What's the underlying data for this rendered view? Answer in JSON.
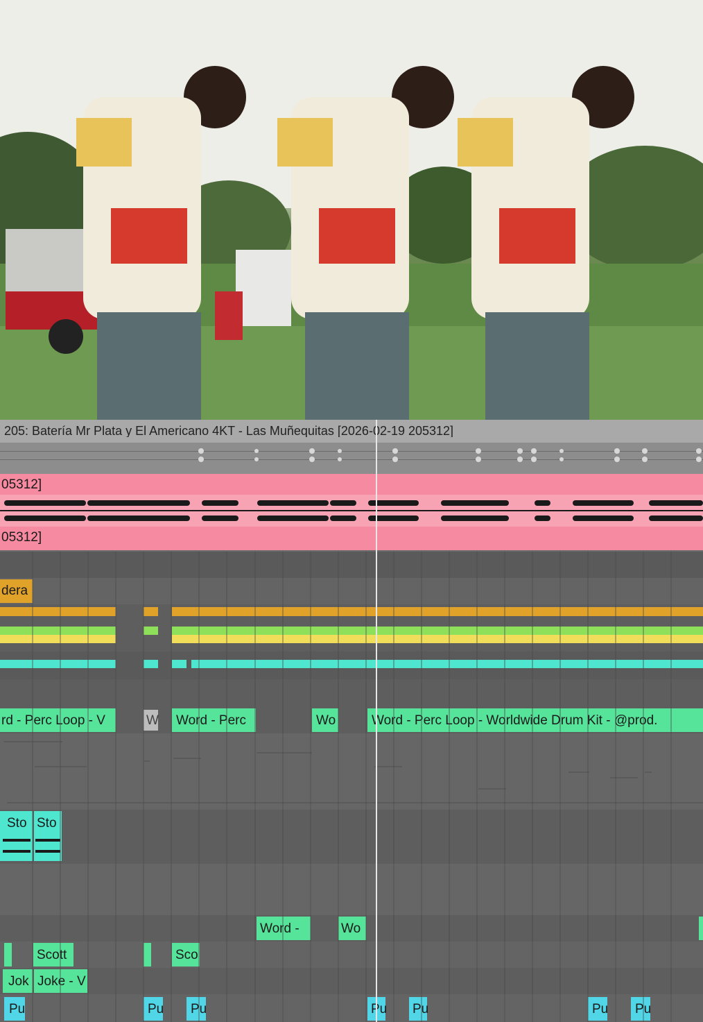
{
  "daw": {
    "clip_title": "205: Batería Mr Plata y El Americano 4KT - Las Muñequitas [2026-02-19 205312]",
    "audio_label_top": "05312]",
    "audio_label_bottom": "05312]",
    "track_clips": {
      "orange_label": "dera",
      "perc_a": "rd - Perc Loop - V",
      "perc_b": "W",
      "perc_c": "Word - Perc",
      "perc_d": "Wo",
      "perc_e": "Word - Perc Loop - Worldwide Drum Kit - @prod.",
      "sto_a": "Sto",
      "sto_b": "Sto",
      "word_a": "Word -",
      "word_b": "Wo",
      "scott_a": "Scott",
      "scott_b": "Sco",
      "joke_a": "Jok",
      "joke_b": "Joke - V",
      "pu_1": "Pu",
      "pu_2": "Pu",
      "pu_3": "Pu",
      "pu_4": "Pu",
      "pu_5": "Pu",
      "pu_6": "Pu",
      "pu_7": "Pu"
    },
    "colors": {
      "audio_clip": "#f58aa0",
      "orange": "#e1a22a",
      "green": "#8ee05a",
      "yellow": "#f0de5a",
      "cyan": "#4fe6cf",
      "green_clip": "#56e39a",
      "blue_clip": "#50d6e6"
    }
  }
}
